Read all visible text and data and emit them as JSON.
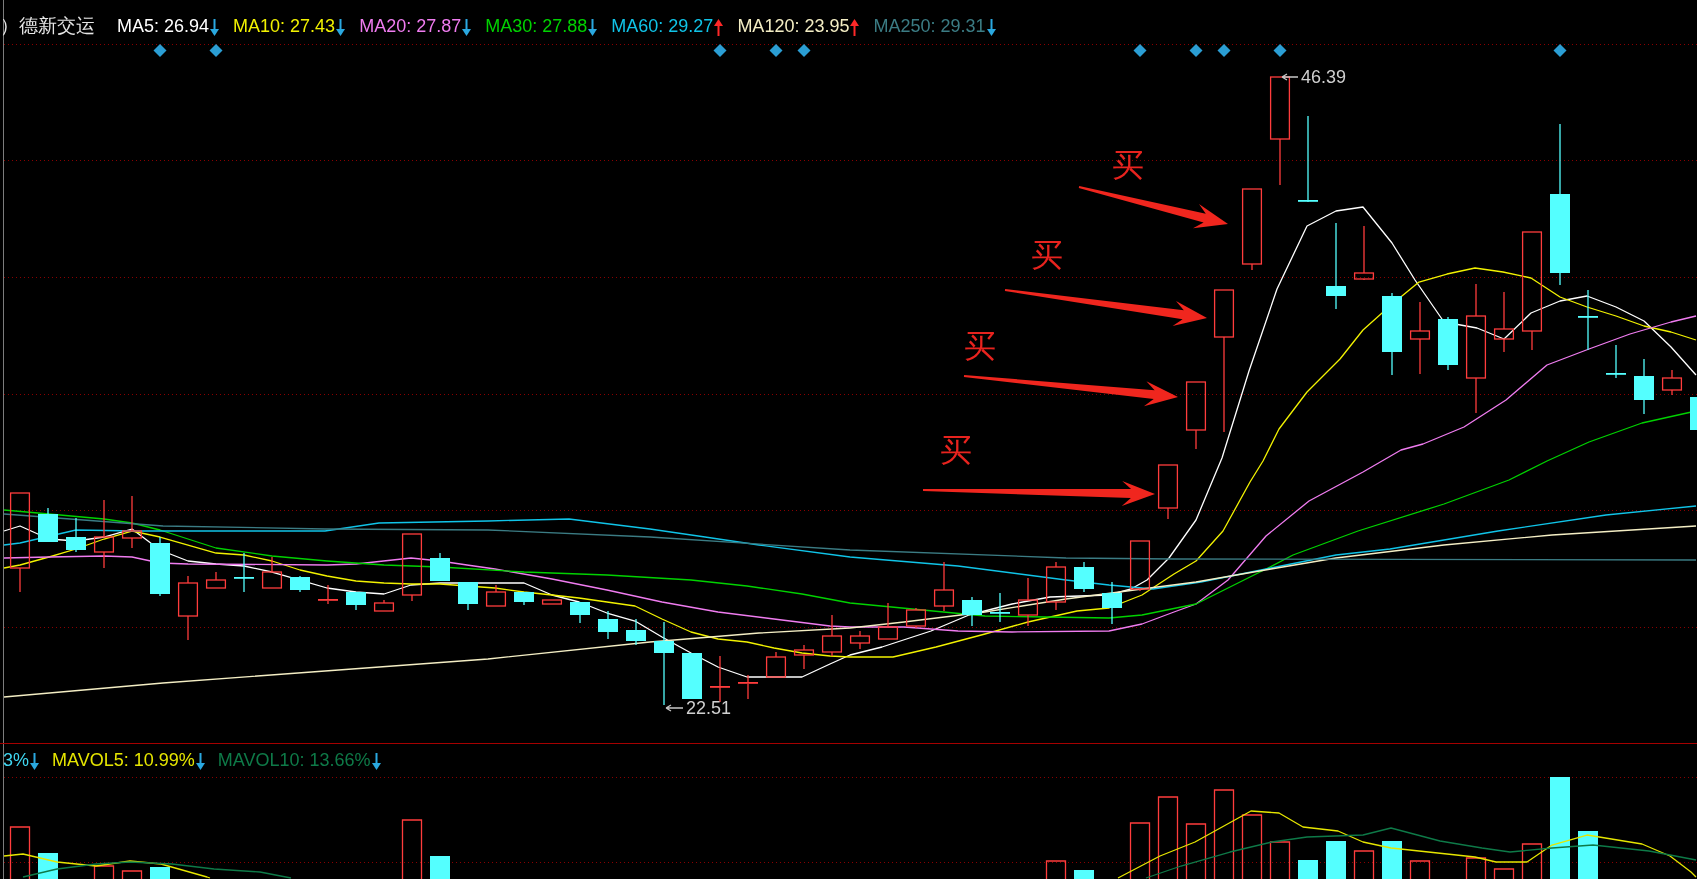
{
  "price_panel": {
    "title": "）德新交运",
    "indicators": [
      {
        "label": "MA5: 26.94",
        "color": "#ffffff",
        "arrow": {
          "kind": "down",
          "color": "#2aa8e0"
        }
      },
      {
        "label": "MA10: 27.43",
        "color": "#f2f200",
        "arrow": {
          "kind": "down",
          "color": "#2aa8e0"
        }
      },
      {
        "label": "MA20: 27.87",
        "color": "#f07cf0",
        "arrow": {
          "kind": "down",
          "color": "#2aa8e0"
        }
      },
      {
        "label": "MA30: 27.88",
        "color": "#00d200",
        "arrow": {
          "kind": "down",
          "color": "#2aa8e0"
        }
      },
      {
        "label": "MA60: 29.27",
        "color": "#10c4e8",
        "arrow": {
          "kind": "up",
          "color": "#ff2828"
        }
      },
      {
        "label": "MA120: 23.95",
        "color": "#f4eec4",
        "arrow": {
          "kind": "up",
          "color": "#ff2828"
        }
      },
      {
        "label": "MA250: 29.31",
        "color": "#3b7c84",
        "arrow": {
          "kind": "down",
          "color": "#2aa8e0"
        }
      }
    ],
    "high_label": "46.39",
    "low_label": "22.51",
    "annotations": [
      {
        "text": "买"
      },
      {
        "text": "买"
      },
      {
        "text": "买"
      },
      {
        "text": "买"
      }
    ]
  },
  "volume_panel": {
    "indicators": [
      {
        "label": "3%",
        "color": "#3fd6f0",
        "arrow": {
          "kind": "down",
          "color": "#2aa8e0"
        }
      },
      {
        "label": "MAVOL5: 10.99%",
        "color": "#e6e600",
        "arrow": {
          "kind": "down",
          "color": "#2aa8e0"
        }
      },
      {
        "label": "MAVOL10: 13.66%",
        "color": "#0e7a48",
        "arrow": {
          "kind": "down",
          "color": "#2aa8e0"
        }
      }
    ]
  }
}
